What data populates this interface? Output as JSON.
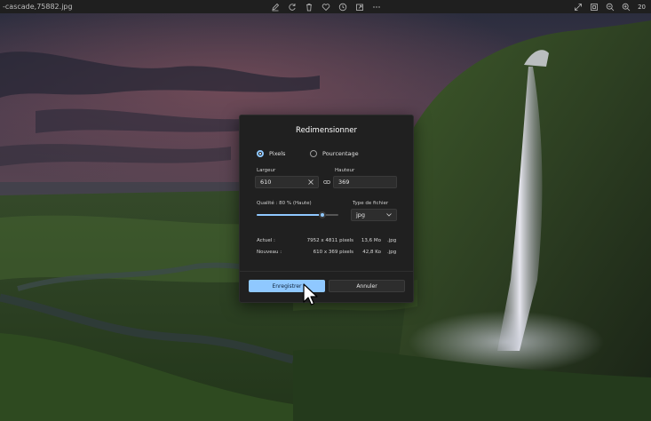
{
  "window": {
    "filename": "-cascade,75882.jpg",
    "zoom_label": "20"
  },
  "toolbar": {
    "icons": [
      "edit-icon",
      "rotate-icon",
      "delete-icon",
      "favorite-icon",
      "info-icon",
      "share-icon",
      "more-icon"
    ],
    "right_icons": [
      "fullscreen-icon",
      "fit-icon",
      "zoom-out-icon",
      "zoom-in-icon"
    ]
  },
  "dialog": {
    "title": "Redimensionner",
    "mode_options": [
      {
        "label": "Pixels",
        "selected": true
      },
      {
        "label": "Pourcentage",
        "selected": false
      }
    ],
    "width_label": "Largeur",
    "width_value": "610",
    "height_label": "Hauteur",
    "height_value": "369",
    "quality_label": "Qualité : 80 % (Haute)",
    "quality_value": 80,
    "filetype_label": "Type de fichier",
    "filetype_value": "jpg",
    "current_label": "Actuel :",
    "current_dims": "7952 x 4811 pixels",
    "current_size": "13,6 Mo",
    "current_ext": ".jpg",
    "new_label": "Nouveau :",
    "new_dims": "610 x 369 pixels",
    "new_size": "42,8 Ko",
    "new_ext": ".jpg",
    "save_button": "Enregistrer",
    "cancel_button": "Annuler"
  },
  "colors": {
    "accent": "#8fc8ff",
    "dialog_bg": "#202020",
    "topbar_bg": "#1f1f1f"
  }
}
